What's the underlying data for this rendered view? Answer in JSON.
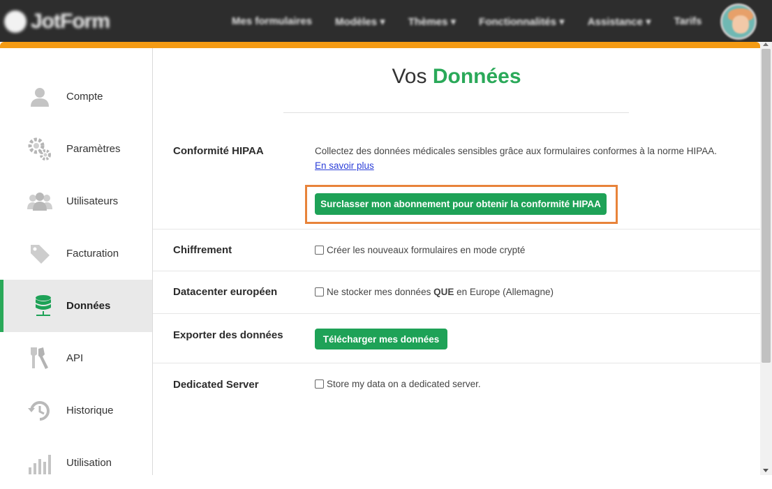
{
  "header": {
    "logo_text": "JotForm",
    "nav": [
      "Mes formulaires",
      "Modèles ▾",
      "Thèmes ▾",
      "Fonctionnalités ▾",
      "Assistance ▾",
      "Tarifs"
    ],
    "accent_color": "#f49b14"
  },
  "sidebar": {
    "items": [
      {
        "label": "Compte",
        "icon": "user-icon"
      },
      {
        "label": "Paramètres",
        "icon": "gears-icon"
      },
      {
        "label": "Utilisateurs",
        "icon": "users-icon"
      },
      {
        "label": "Facturation",
        "icon": "tag-icon"
      },
      {
        "label": "Données",
        "icon": "database-icon",
        "active": true
      },
      {
        "label": "API",
        "icon": "keys-icon"
      },
      {
        "label": "Historique",
        "icon": "history-icon"
      },
      {
        "label": "Utilisation",
        "icon": "bar-chart-icon"
      }
    ],
    "active_color": "#2aa959"
  },
  "main": {
    "title_plain": "Vos",
    "title_accent": "Données",
    "sections": {
      "hipaa": {
        "label": "Conformité HIPAA",
        "description": "Collectez des données médicales sensibles grâce aux formulaires conformes à la norme HIPAA.",
        "link": "En savoir plus",
        "button": "Surclasser mon abonnement pour obtenir la conformité HIPAA"
      },
      "encryption": {
        "label": "Chiffrement",
        "checkbox": "Créer les nouveaux formulaires en mode crypté",
        "checked": false
      },
      "eu_datacenter": {
        "label": "Datacenter européen",
        "checkbox_pre": "Ne stocker mes données",
        "checkbox_bold": "QUE",
        "checkbox_post": "en Europe (Allemagne)",
        "checked": false
      },
      "export": {
        "label": "Exporter des données",
        "button": "Télécharger mes données"
      },
      "dedicated": {
        "label": "Dedicated Server",
        "checkbox": "Store my data on a dedicated server.",
        "checked": false
      }
    },
    "button_color": "#1ea257",
    "highlight_color": "#e8833a"
  }
}
